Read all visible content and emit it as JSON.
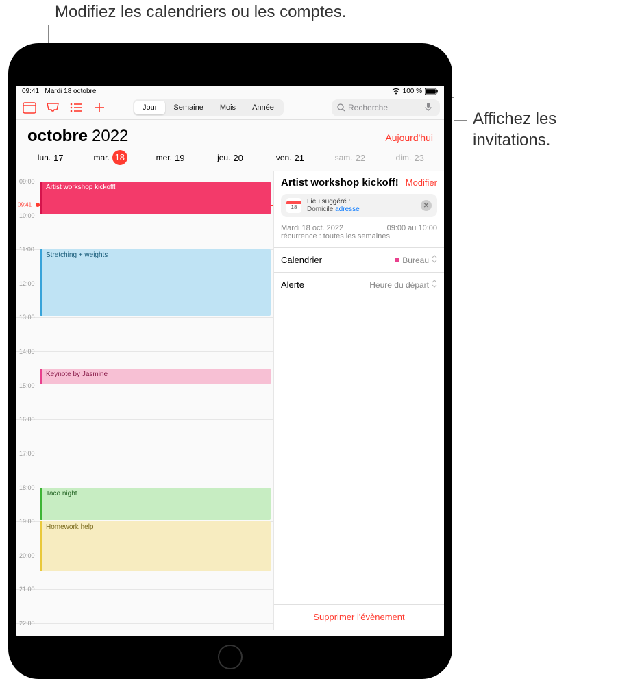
{
  "callouts": {
    "top": "Modifiez les calendriers ou les comptes.",
    "right_l1": "Affichez les",
    "right_l2": "invitations."
  },
  "status": {
    "time": "09:41",
    "date": "Mardi 18 octobre",
    "battery": "100 %"
  },
  "segmented": {
    "day": "Jour",
    "week": "Semaine",
    "month": "Mois",
    "year": "Année"
  },
  "search": {
    "placeholder": "Recherche"
  },
  "header": {
    "month": "octobre",
    "year": "2022",
    "today": "Aujourd'hui"
  },
  "weekdays": [
    {
      "label": "lun.",
      "num": "17",
      "today": false,
      "weekend": false
    },
    {
      "label": "mar.",
      "num": "18",
      "today": true,
      "weekend": false
    },
    {
      "label": "mer.",
      "num": "19",
      "today": false,
      "weekend": false
    },
    {
      "label": "jeu.",
      "num": "20",
      "today": false,
      "weekend": false
    },
    {
      "label": "ven.",
      "num": "21",
      "today": false,
      "weekend": false
    },
    {
      "label": "sam.",
      "num": "22",
      "today": false,
      "weekend": true
    },
    {
      "label": "dim.",
      "num": "23",
      "today": false,
      "weekend": true
    }
  ],
  "timeline": {
    "now_label": "09:41",
    "hours": [
      "09:00",
      "10:00",
      "11:00",
      "12:00",
      "13:00",
      "14:00",
      "15:00",
      "16:00",
      "17:00",
      "18:00",
      "19:00",
      "20:00",
      "21:00",
      "22:00"
    ]
  },
  "events": [
    {
      "title": "Artist workshop kickoff!",
      "start": 9.0,
      "end": 10.0,
      "cls": "event-pink"
    },
    {
      "title": "Stretching + weights",
      "start": 11.0,
      "end": 13.0,
      "cls": "event-blue"
    },
    {
      "title": "Keynote by Jasmine",
      "start": 14.5,
      "end": 15.0,
      "cls": "event-rose"
    },
    {
      "title": "Taco night",
      "start": 18.0,
      "end": 19.0,
      "cls": "event-green"
    },
    {
      "title": "Homework help",
      "start": 19.0,
      "end": 20.5,
      "cls": "event-yellow"
    }
  ],
  "detail": {
    "title": "Artist workshop kickoff!",
    "modify": "Modifier",
    "loc_day": "18",
    "loc_label": "Lieu suggéré :",
    "loc_place": "Domicile ",
    "loc_addr": "adresse",
    "date": "Mardi 18 oct. 2022",
    "time": "09:00 au 10:00",
    "recurrence": "récurrence : toutes les semaines",
    "calendar_label": "Calendrier",
    "calendar_value": "Bureau",
    "alert_label": "Alerte",
    "alert_value": "Heure du départ",
    "delete": "Supprimer l'évènement"
  }
}
